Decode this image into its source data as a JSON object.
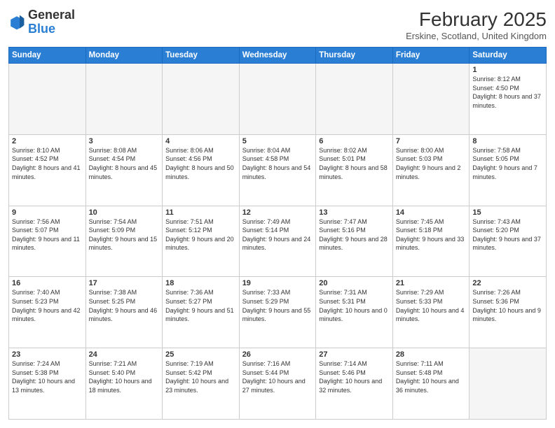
{
  "header": {
    "logo_line1": "General",
    "logo_line2": "Blue",
    "month_title": "February 2025",
    "subtitle": "Erskine, Scotland, United Kingdom"
  },
  "days_of_week": [
    "Sunday",
    "Monday",
    "Tuesday",
    "Wednesday",
    "Thursday",
    "Friday",
    "Saturday"
  ],
  "weeks": [
    [
      {
        "day": "",
        "info": ""
      },
      {
        "day": "",
        "info": ""
      },
      {
        "day": "",
        "info": ""
      },
      {
        "day": "",
        "info": ""
      },
      {
        "day": "",
        "info": ""
      },
      {
        "day": "",
        "info": ""
      },
      {
        "day": "1",
        "info": "Sunrise: 8:12 AM\nSunset: 4:50 PM\nDaylight: 8 hours and 37 minutes."
      }
    ],
    [
      {
        "day": "2",
        "info": "Sunrise: 8:10 AM\nSunset: 4:52 PM\nDaylight: 8 hours and 41 minutes."
      },
      {
        "day": "3",
        "info": "Sunrise: 8:08 AM\nSunset: 4:54 PM\nDaylight: 8 hours and 45 minutes."
      },
      {
        "day": "4",
        "info": "Sunrise: 8:06 AM\nSunset: 4:56 PM\nDaylight: 8 hours and 50 minutes."
      },
      {
        "day": "5",
        "info": "Sunrise: 8:04 AM\nSunset: 4:58 PM\nDaylight: 8 hours and 54 minutes."
      },
      {
        "day": "6",
        "info": "Sunrise: 8:02 AM\nSunset: 5:01 PM\nDaylight: 8 hours and 58 minutes."
      },
      {
        "day": "7",
        "info": "Sunrise: 8:00 AM\nSunset: 5:03 PM\nDaylight: 9 hours and 2 minutes."
      },
      {
        "day": "8",
        "info": "Sunrise: 7:58 AM\nSunset: 5:05 PM\nDaylight: 9 hours and 7 minutes."
      }
    ],
    [
      {
        "day": "9",
        "info": "Sunrise: 7:56 AM\nSunset: 5:07 PM\nDaylight: 9 hours and 11 minutes."
      },
      {
        "day": "10",
        "info": "Sunrise: 7:54 AM\nSunset: 5:09 PM\nDaylight: 9 hours and 15 minutes."
      },
      {
        "day": "11",
        "info": "Sunrise: 7:51 AM\nSunset: 5:12 PM\nDaylight: 9 hours and 20 minutes."
      },
      {
        "day": "12",
        "info": "Sunrise: 7:49 AM\nSunset: 5:14 PM\nDaylight: 9 hours and 24 minutes."
      },
      {
        "day": "13",
        "info": "Sunrise: 7:47 AM\nSunset: 5:16 PM\nDaylight: 9 hours and 28 minutes."
      },
      {
        "day": "14",
        "info": "Sunrise: 7:45 AM\nSunset: 5:18 PM\nDaylight: 9 hours and 33 minutes."
      },
      {
        "day": "15",
        "info": "Sunrise: 7:43 AM\nSunset: 5:20 PM\nDaylight: 9 hours and 37 minutes."
      }
    ],
    [
      {
        "day": "16",
        "info": "Sunrise: 7:40 AM\nSunset: 5:23 PM\nDaylight: 9 hours and 42 minutes."
      },
      {
        "day": "17",
        "info": "Sunrise: 7:38 AM\nSunset: 5:25 PM\nDaylight: 9 hours and 46 minutes."
      },
      {
        "day": "18",
        "info": "Sunrise: 7:36 AM\nSunset: 5:27 PM\nDaylight: 9 hours and 51 minutes."
      },
      {
        "day": "19",
        "info": "Sunrise: 7:33 AM\nSunset: 5:29 PM\nDaylight: 9 hours and 55 minutes."
      },
      {
        "day": "20",
        "info": "Sunrise: 7:31 AM\nSunset: 5:31 PM\nDaylight: 10 hours and 0 minutes."
      },
      {
        "day": "21",
        "info": "Sunrise: 7:29 AM\nSunset: 5:33 PM\nDaylight: 10 hours and 4 minutes."
      },
      {
        "day": "22",
        "info": "Sunrise: 7:26 AM\nSunset: 5:36 PM\nDaylight: 10 hours and 9 minutes."
      }
    ],
    [
      {
        "day": "23",
        "info": "Sunrise: 7:24 AM\nSunset: 5:38 PM\nDaylight: 10 hours and 13 minutes."
      },
      {
        "day": "24",
        "info": "Sunrise: 7:21 AM\nSunset: 5:40 PM\nDaylight: 10 hours and 18 minutes."
      },
      {
        "day": "25",
        "info": "Sunrise: 7:19 AM\nSunset: 5:42 PM\nDaylight: 10 hours and 23 minutes."
      },
      {
        "day": "26",
        "info": "Sunrise: 7:16 AM\nSunset: 5:44 PM\nDaylight: 10 hours and 27 minutes."
      },
      {
        "day": "27",
        "info": "Sunrise: 7:14 AM\nSunset: 5:46 PM\nDaylight: 10 hours and 32 minutes."
      },
      {
        "day": "28",
        "info": "Sunrise: 7:11 AM\nSunset: 5:48 PM\nDaylight: 10 hours and 36 minutes."
      },
      {
        "day": "",
        "info": ""
      }
    ]
  ]
}
